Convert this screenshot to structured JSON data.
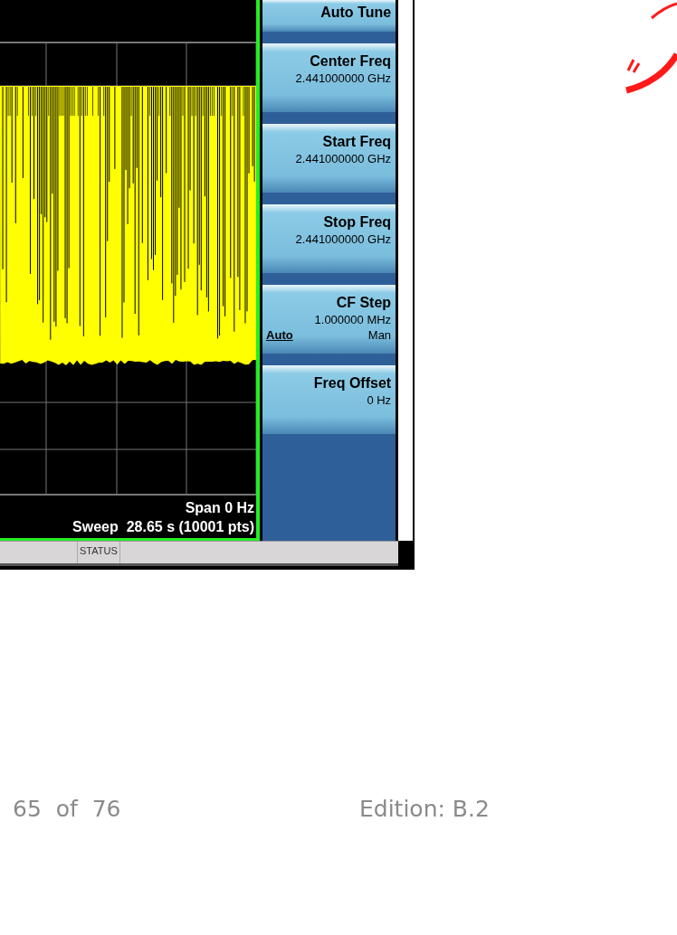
{
  "softkeys": [
    {
      "kind": "plain",
      "title": "Auto Tune"
    },
    {
      "kind": "value",
      "title": "Center Freq",
      "value": "2.441000000 GHz"
    },
    {
      "kind": "value",
      "title": "Start Freq",
      "value": "2.441000000 GHz"
    },
    {
      "kind": "value",
      "title": "Stop Freq",
      "value": "2.441000000 GHz"
    },
    {
      "kind": "toggle",
      "title": "CF Step",
      "value": "1.000000 MHz",
      "options": [
        {
          "label": "Auto",
          "selected": true
        },
        {
          "label": "Man",
          "selected": false
        }
      ]
    },
    {
      "kind": "value",
      "title": "Freq Offset",
      "value": "0 Hz"
    }
  ],
  "display": {
    "span": "Span 0 Hz",
    "sweep": "Sweep  28.65 s (10001 pts)"
  },
  "status_bar": {
    "label": "STATUS"
  },
  "footer": {
    "page": "65  of  76",
    "edition": "Edition: B.2"
  }
}
